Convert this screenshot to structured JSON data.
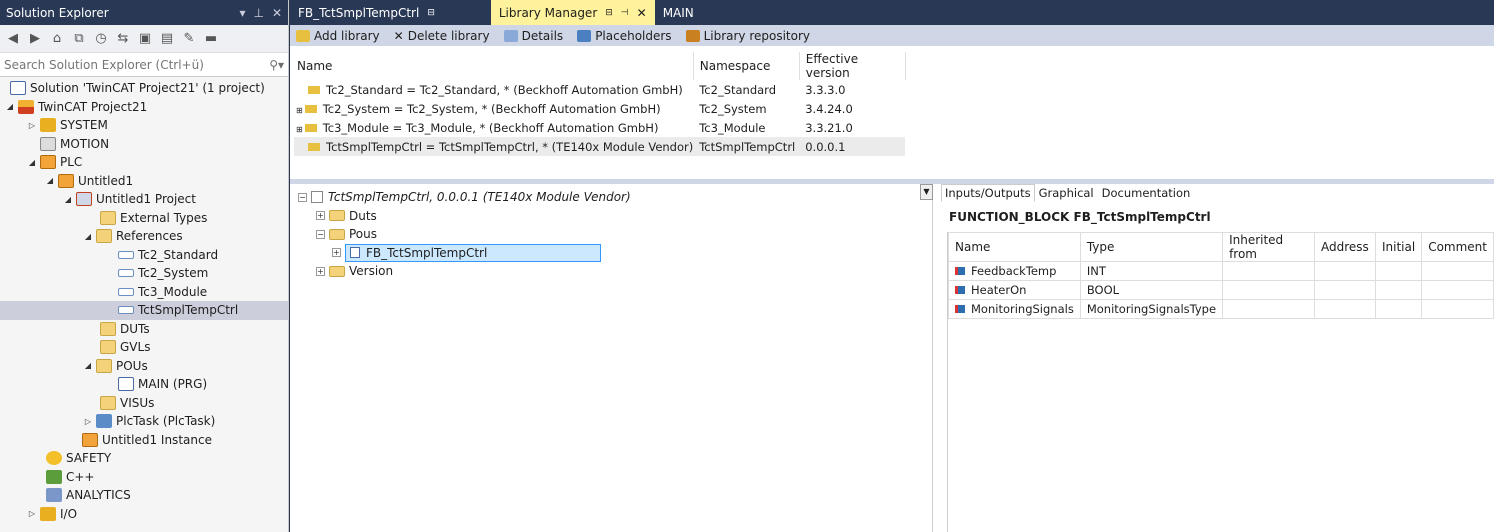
{
  "solution_explorer": {
    "title": "Solution Explorer",
    "search_placeholder": "Search Solution Explorer (Ctrl+ü)",
    "tree": [
      {
        "label": "Solution 'TwinCAT Project21' (1 project)"
      },
      {
        "label": "TwinCAT Project21"
      },
      {
        "label": "SYSTEM"
      },
      {
        "label": "MOTION"
      },
      {
        "label": "PLC"
      },
      {
        "label": "Untitled1"
      },
      {
        "label": "Untitled1 Project"
      },
      {
        "label": "External Types"
      },
      {
        "label": "References"
      },
      {
        "label": "Tc2_Standard"
      },
      {
        "label": "Tc2_System"
      },
      {
        "label": "Tc3_Module"
      },
      {
        "label": "TctSmplTempCtrl"
      },
      {
        "label": "DUTs"
      },
      {
        "label": "GVLs"
      },
      {
        "label": "POUs"
      },
      {
        "label": "MAIN (PRG)"
      },
      {
        "label": "VISUs"
      },
      {
        "label": "PlcTask (PlcTask)"
      },
      {
        "label": "Untitled1 Instance"
      },
      {
        "label": "SAFETY"
      },
      {
        "label": "C++"
      },
      {
        "label": "ANALYTICS"
      },
      {
        "label": "I/O"
      }
    ]
  },
  "doc_tabs": [
    {
      "label": "FB_TctSmplTempCtrl"
    },
    {
      "label": "Library Manager"
    },
    {
      "label": "MAIN"
    }
  ],
  "library_manager": {
    "toolbar": {
      "add": "Add library",
      "delete": "Delete library",
      "details": "Details",
      "placeholders": "Placeholders",
      "repository": "Library repository"
    },
    "columns": {
      "name": "Name",
      "namespace": "Namespace",
      "version": "Effective version"
    },
    "libraries": [
      {
        "name": "Tc2_Standard = Tc2_Standard, * (Beckhoff Automation GmbH)",
        "namespace": "Tc2_Standard",
        "version": "3.3.3.0"
      },
      {
        "name": "Tc2_System = Tc2_System, * (Beckhoff Automation GmbH)",
        "namespace": "Tc2_System",
        "version": "3.4.24.0"
      },
      {
        "name": "Tc3_Module = Tc3_Module, * (Beckhoff Automation GmbH)",
        "namespace": "Tc3_Module",
        "version": "3.3.21.0"
      },
      {
        "name": "TctSmplTempCtrl = TctSmplTempCtrl, * (TE140x Module Vendor)",
        "namespace": "TctSmplTempCtrl",
        "version": "0.0.0.1"
      }
    ],
    "lib_tree": {
      "root": "TctSmplTempCtrl, 0.0.0.1 (TE140x Module Vendor)",
      "duts": "Duts",
      "pous": "Pous",
      "fb": "FB_TctSmplTempCtrl",
      "version": "Version"
    },
    "right_tabs": {
      "io": "Inputs/Outputs",
      "graphical": "Graphical",
      "doc": "Documentation"
    },
    "fb_title_prefix": "FUNCTION_BLOCK",
    "fb_title_name": "FB_TctSmplTempCtrl",
    "var_columns": {
      "name": "Name",
      "type": "Type",
      "inherited": "Inherited from",
      "address": "Address",
      "initial": "Initial",
      "comment": "Comment"
    },
    "variables": [
      {
        "name": "FeedbackTemp",
        "type": "INT"
      },
      {
        "name": "HeaterOn",
        "type": "BOOL"
      },
      {
        "name": "MonitoringSignals",
        "type": "MonitoringSignalsType"
      }
    ]
  }
}
